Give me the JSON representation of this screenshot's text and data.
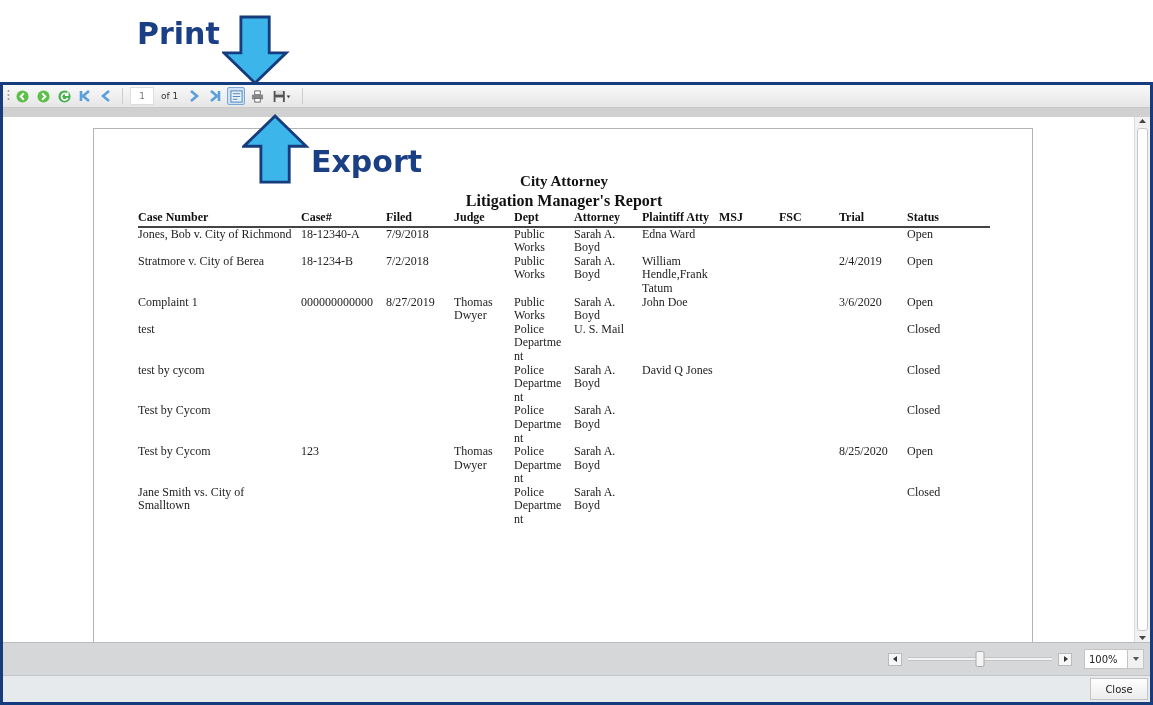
{
  "annotations": [
    {
      "label": "Print",
      "kind": "down"
    },
    {
      "label": "Export",
      "kind": "up"
    }
  ],
  "toolbar": {
    "page": "1",
    "page_count": "of 1",
    "print_layout_pressed": true
  },
  "report": {
    "title": "City Attorney",
    "subtitle": "Litigation Manager's Report",
    "columns": [
      "Case Number",
      "Case#",
      "Filed",
      "Judge",
      "Dept",
      "Attorney",
      "Plaintiff Atty",
      "MSJ",
      "FSC",
      "Trial",
      "Status"
    ],
    "rows": [
      [
        "Jones, Bob v. City of Richmond",
        "18-12340-A",
        "7/9/2018",
        "",
        "Public Works",
        "Sarah A. Boyd",
        "Edna Ward",
        "",
        "",
        "",
        "Open"
      ],
      [
        "Stratmore v. City of Berea",
        "18-1234-B",
        "7/2/2018",
        "",
        "Public Works",
        "Sarah A. Boyd",
        "William Hendle,Frank Tatum",
        "",
        "",
        "2/4/2019",
        "Open"
      ],
      [
        "Complaint 1",
        "000000000000",
        "8/27/2019",
        "Thomas Dwyer",
        "Public Works",
        "Sarah A. Boyd",
        "John Doe",
        "",
        "",
        "3/6/2020",
        "Open"
      ],
      [
        "test",
        "",
        "",
        "",
        "Police Department",
        "U. S. Mail",
        "",
        "",
        "",
        "",
        "Closed"
      ],
      [
        "test by cycom",
        "",
        "",
        "",
        "Police Department",
        "Sarah A. Boyd",
        "David Q Jones",
        "",
        "",
        "",
        "Closed"
      ],
      [
        "Test by Cycom",
        "",
        "",
        "",
        "Police Department",
        "Sarah A. Boyd",
        "",
        "",
        "",
        "",
        "Closed"
      ],
      [
        "Test by Cycom",
        "123",
        "",
        "Thomas Dwyer",
        "Police Department",
        "Sarah A. Boyd",
        "",
        "",
        "",
        "8/25/2020",
        "Open"
      ],
      [
        "Jane Smith vs. City of Smalltown",
        "",
        "",
        "",
        "Police Department",
        "Sarah A. Boyd",
        "",
        "",
        "",
        "",
        "Closed"
      ]
    ]
  },
  "zoom": {
    "level": 0.5,
    "value": "100%"
  },
  "buttons": [
    "Close"
  ]
}
